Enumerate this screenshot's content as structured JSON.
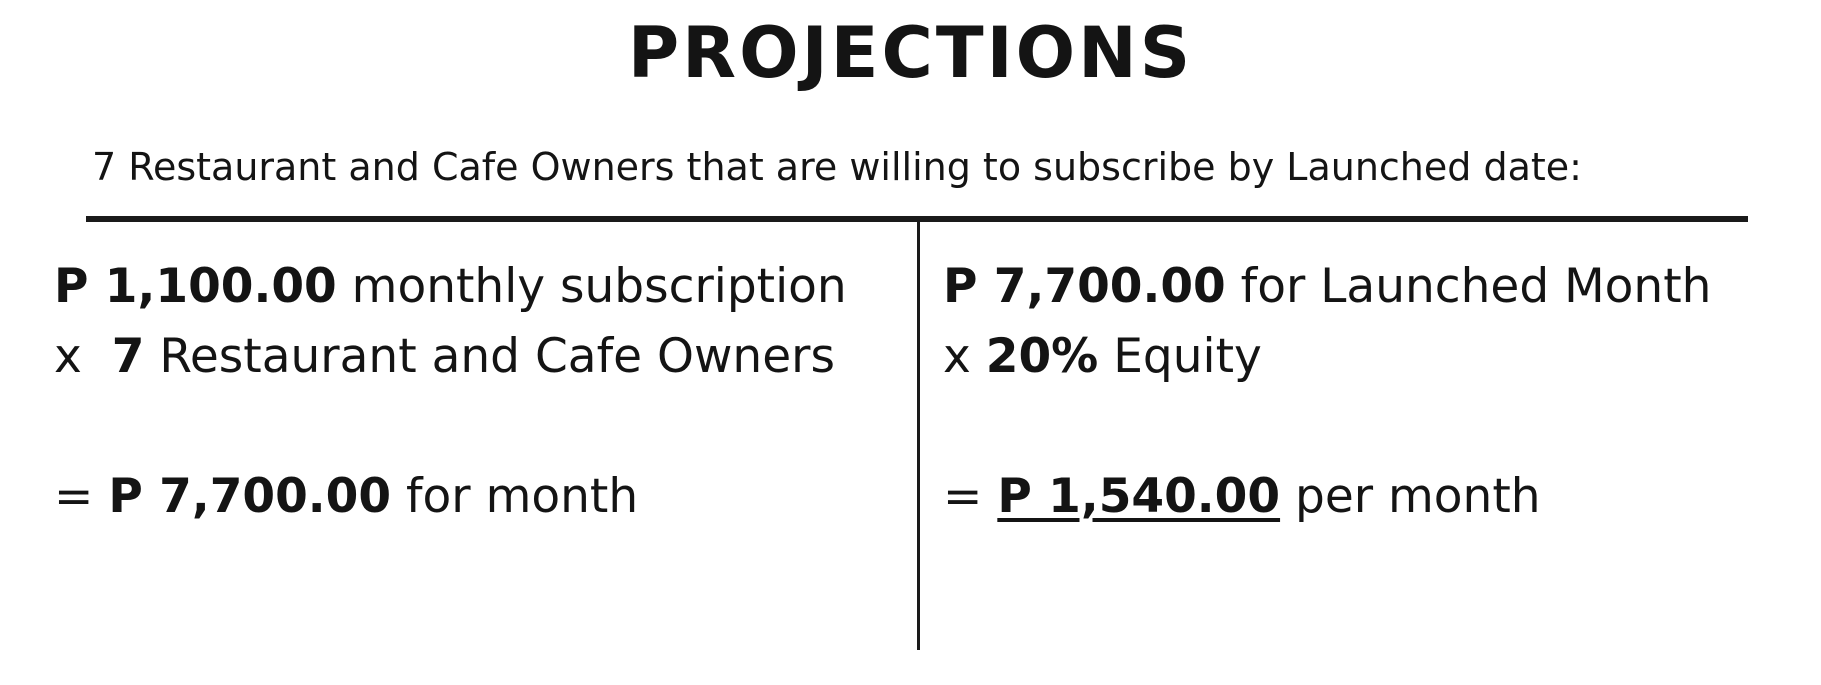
{
  "title": "PROJECTIONS",
  "subtitle": "7 Restaurant and Cafe Owners that are willing to subscribe by Launched date:",
  "left": {
    "line1": {
      "amount": "P 1,100.00",
      "text": " monthly subscription"
    },
    "line2": {
      "prefix": "x  ",
      "amount": "7",
      "text": " Restaurant and Cafe Owners"
    },
    "line3": {
      "prefix": "= ",
      "amount": "P 7,700.00",
      "text": " for month"
    }
  },
  "right": {
    "line1": {
      "amount": "P 7,700.00",
      "text": " for Launched Month"
    },
    "line2": {
      "prefix": "x ",
      "amount": "20%",
      "text": " Equity"
    },
    "line3": {
      "prefix": "= ",
      "amount": "P 1,540.00",
      "text": " per month"
    }
  },
  "colors": {
    "text": "#141414",
    "rule": "#1a1a1a",
    "background": "#ffffff"
  }
}
